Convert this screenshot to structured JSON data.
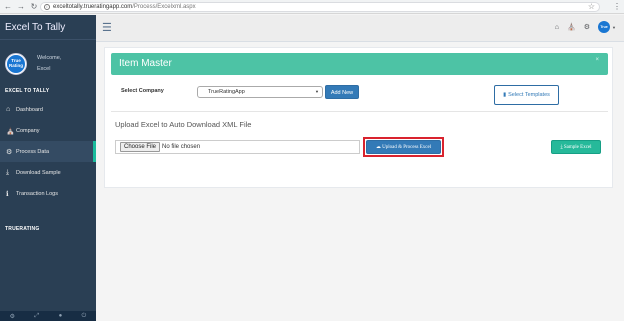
{
  "browser": {
    "url_domain": "exceltotally.trueratingapp.com",
    "url_path": "/Process/Excelxml.aspx"
  },
  "sidebar": {
    "brand": "Excel To Tally",
    "avatar_text": "True Rating",
    "welcome": "Welcome,",
    "user": "Excel",
    "section_title": "EXCEL TO TALLY",
    "items": [
      {
        "label": "Dashboard",
        "icon": "home-icon"
      },
      {
        "label": "Company",
        "icon": "bank-icon"
      },
      {
        "label": "Process Data",
        "icon": "cogs-icon"
      },
      {
        "label": "Download Sample",
        "icon": "download-icon"
      },
      {
        "label": "Transaction Logs",
        "icon": "info-icon"
      }
    ],
    "section_title_2": "TRUERATING"
  },
  "topbar": {
    "avatar_text": "True"
  },
  "panel": {
    "title": "Item Master",
    "company_label": "Select Company",
    "company_value": "TrueRatingApp",
    "add_new_label": "Add New",
    "templates_label": "Select Templates",
    "upload_heading": "Upload Excel to Auto Download XML File",
    "choose_file_label": "Choose File",
    "no_file_text": "No file chosen",
    "upload_button_label": "Upload & Process Excel",
    "sample_button_label": "Sample Excel"
  },
  "colors": {
    "sidebar_bg": "#2a3f54",
    "header_green": "#4dc3a5",
    "primary_blue": "#337ab7",
    "success_green": "#26b99a",
    "highlight_red": "#d9232e"
  }
}
